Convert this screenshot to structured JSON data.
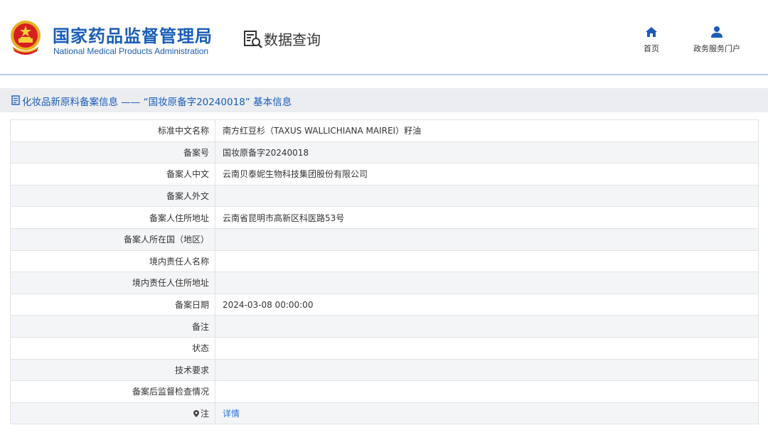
{
  "header": {
    "emblem_icon": "national-emblem-icon",
    "title_cn": "国家药品监督管理局",
    "title_en": "National Medical Products Administration",
    "query_icon": "database-search-icon",
    "query_title": "数据查询",
    "nav": [
      {
        "icon": "home-icon",
        "label": "首页"
      },
      {
        "icon": "user-icon",
        "label": "政务服务门户"
      }
    ]
  },
  "section": {
    "icon": "document-icon",
    "title": "化妆品新原料备案信息 —— “国妆原备字20240018” 基本信息"
  },
  "rows": [
    {
      "label": "标准中文名称",
      "value": "南方红豆杉（TAXUS WALLICHIANA MAIREI）籽油"
    },
    {
      "label": "备案号",
      "value": "国妆原备字20240018"
    },
    {
      "label": "备案人中文",
      "value": "云南贝泰妮生物科技集团股份有限公司"
    },
    {
      "label": "备案人外文",
      "value": ""
    },
    {
      "label": "备案人住所地址",
      "value": "云南省昆明市高新区科医路53号"
    },
    {
      "label": "备案人所在国（地区）",
      "value": ""
    },
    {
      "label": "境内责任人名称",
      "value": ""
    },
    {
      "label": "境内责任人住所地址",
      "value": ""
    },
    {
      "label": "备案日期",
      "value": "2024-03-08 00:00:00"
    },
    {
      "label": "备注",
      "value": ""
    },
    {
      "label": "状态",
      "value": ""
    },
    {
      "label": "技术要求",
      "value": ""
    },
    {
      "label": "备案后监督检查情况",
      "value": ""
    },
    {
      "label": "注",
      "value": "详情",
      "link": true,
      "icon": "pin-icon"
    }
  ],
  "colors": {
    "brand_blue": "#1a5cb8",
    "link_blue": "#2a6fd6",
    "title_bar_bg": "#ebedf0",
    "row_alt_bg": "#f4f5f7"
  }
}
